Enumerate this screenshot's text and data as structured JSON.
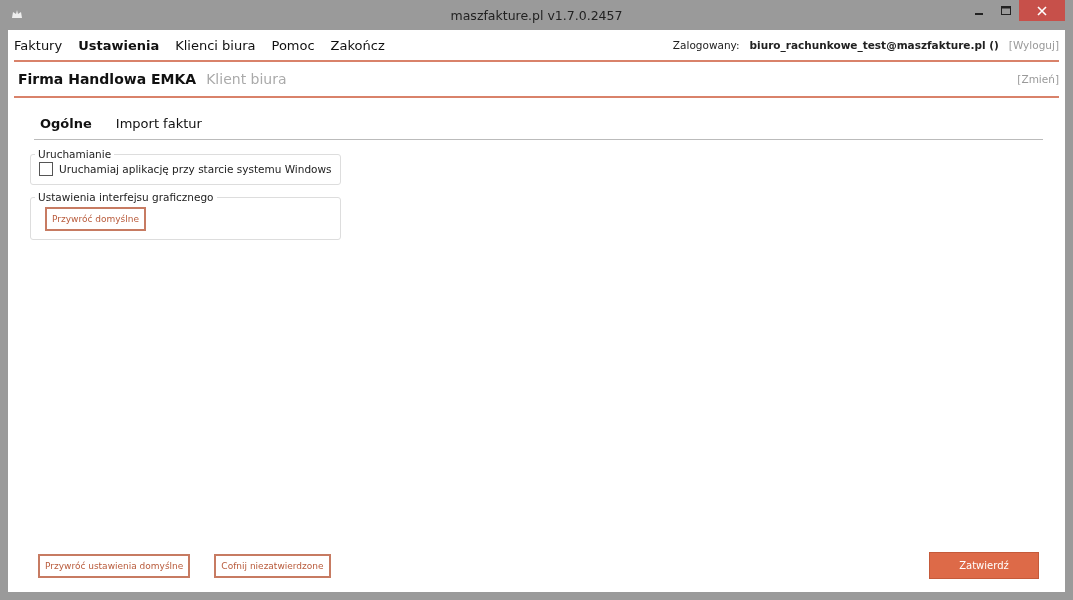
{
  "window": {
    "title": "maszfakture.pl  v1.7.0.2457"
  },
  "menu": [
    {
      "label": "Faktury",
      "selected": false
    },
    {
      "label": "Ustawienia",
      "selected": true
    },
    {
      "label": "Klienci biura",
      "selected": false
    },
    {
      "label": "Pomoc",
      "selected": false
    },
    {
      "label": "Zakończ",
      "selected": false
    }
  ],
  "user": {
    "label": "Zalogowany:",
    "email": "biuro_rachunkowe_test@maszfakture.pl ()",
    "logout": "[Wyloguj]"
  },
  "company": {
    "name": "Firma Handlowa EMKA",
    "role": "Klient biura",
    "change": "[Zmień]"
  },
  "tabs": [
    {
      "label": "Ogólne",
      "selected": true
    },
    {
      "label": "Import faktur",
      "selected": false
    }
  ],
  "groups": [
    {
      "title": "Uruchamianie",
      "kind": "checkbox",
      "label": "Uruchamiaj aplikację przy starcie systemu Windows",
      "checked": false
    },
    {
      "title": "Ustawienia interfejsu graficznego",
      "kind": "button",
      "label": "Przywróć domyślne"
    }
  ],
  "footer": {
    "buttons": [
      "Przywróć ustawienia domyślne",
      "Cofnij niezatwierdzone"
    ],
    "confirm": "Zatwierdź"
  }
}
